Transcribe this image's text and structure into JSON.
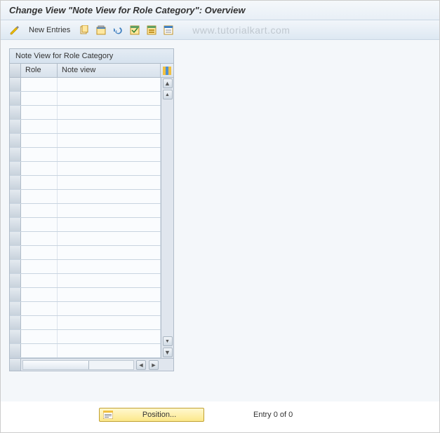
{
  "title": "Change View \"Note View for Role Category\": Overview",
  "toolbar": {
    "new_entries_label": "New Entries"
  },
  "watermark": "www.tutorialkart.com",
  "panel": {
    "title": "Note View for Role Category",
    "columns": {
      "role": "Role",
      "note_view": "Note view"
    },
    "rows": [
      {
        "role": "",
        "note_view": ""
      },
      {
        "role": "",
        "note_view": ""
      },
      {
        "role": "",
        "note_view": ""
      },
      {
        "role": "",
        "note_view": ""
      },
      {
        "role": "",
        "note_view": ""
      },
      {
        "role": "",
        "note_view": ""
      },
      {
        "role": "",
        "note_view": ""
      },
      {
        "role": "",
        "note_view": ""
      },
      {
        "role": "",
        "note_view": ""
      },
      {
        "role": "",
        "note_view": ""
      },
      {
        "role": "",
        "note_view": ""
      },
      {
        "role": "",
        "note_view": ""
      },
      {
        "role": "",
        "note_view": ""
      },
      {
        "role": "",
        "note_view": ""
      },
      {
        "role": "",
        "note_view": ""
      },
      {
        "role": "",
        "note_view": ""
      },
      {
        "role": "",
        "note_view": ""
      },
      {
        "role": "",
        "note_view": ""
      },
      {
        "role": "",
        "note_view": ""
      },
      {
        "role": "",
        "note_view": ""
      }
    ]
  },
  "footer": {
    "position_label": "Position...",
    "entry_status": "Entry 0 of 0"
  }
}
